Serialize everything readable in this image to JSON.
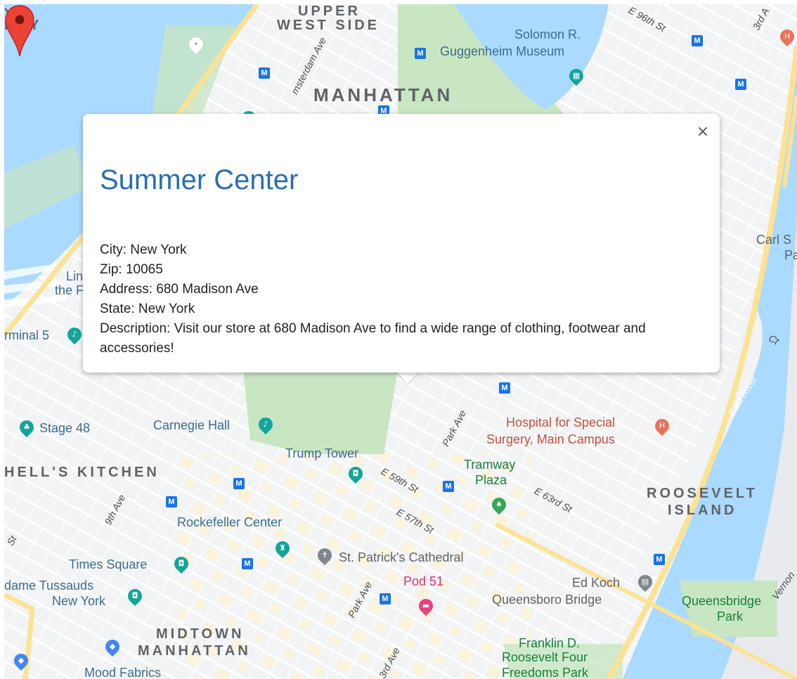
{
  "map": {
    "labels": {
      "upper_west_side_1": "UPPER",
      "upper_west_side_2": "WEST SIDE",
      "top_left_1": "Y &",
      "top_left_2": "RRY",
      "manhattan": "MANHATTAN",
      "guggenheim_1": "Solomon R.",
      "guggenheim_2": "Guggenheim Museum",
      "amsterdam_ave": "msterdam Ave",
      "e96": "E 96th St",
      "third_ave_top": "3rd A",
      "carl_1": "Carl S",
      "carl_2": "Pa",
      "lin_1": "Lin",
      "lin_2": "the F",
      "terminal": "rminal 5",
      "stage48": "Stage 48",
      "carnegie": "Carnegie Hall",
      "trump": "Trump Tower",
      "park_ave_1": "Park Ave",
      "hospital_1": "Hospital for Special",
      "hospital_2": "Surgery, Main Campus",
      "east_river": "East River",
      "hells_kitchen": "HELL'S KITCHEN",
      "e59": "E 59th St",
      "tramway_1": "Tramway",
      "tramway_2": "Plaza",
      "e63": "E 63rd St",
      "roosevelt_1": "ROOSEVELT",
      "roosevelt_2": "ISLAND",
      "ninth_ave": "9th Ave",
      "st": "St",
      "rockefeller": "Rockefeller Center",
      "e57": "E 57th St",
      "times_square": "Times Square",
      "st_patricks": "St. Patrick's Cathedral",
      "tussauds_1": "dame Tussauds",
      "tussauds_2": "New York",
      "pod51": "Pod 51",
      "park_ave_2": "Park Ave",
      "edkoch": "Ed Koch",
      "queensboro": "Queensboro Bridge",
      "queensbridge_1": "Queensbridge",
      "queensbridge_2": "Park",
      "vernon": "Vernon",
      "midtown_1": "MIDTOWN",
      "midtown_2": "MANHATTAN",
      "third_ave": "3rd Ave",
      "franklin_1": "Franklin D.",
      "franklin_2": "Roosevelt Four",
      "franklin_3": "Freedoms Park",
      "mood": "Mood Fabrics",
      "ct": "Ct"
    },
    "metro_glyph": "M",
    "hospital_glyph": "H",
    "colors": {
      "water": "#aadaff",
      "park": "#c8e6c2",
      "land": "#f1f3f4",
      "road": "#ffffff",
      "highway": "#fde293",
      "marker": "#ea4335",
      "title": "#2a6db0"
    }
  },
  "popup": {
    "close_glyph": "×",
    "title": "Summer Center",
    "city": "City: New York",
    "zip": "Zip: 10065",
    "address": "Address: 680 Madison Ave",
    "state": "State: New York",
    "description": "Description: Visit our store at 680 Madison Ave to find a wide range of clothing, footwear and accessories!"
  }
}
